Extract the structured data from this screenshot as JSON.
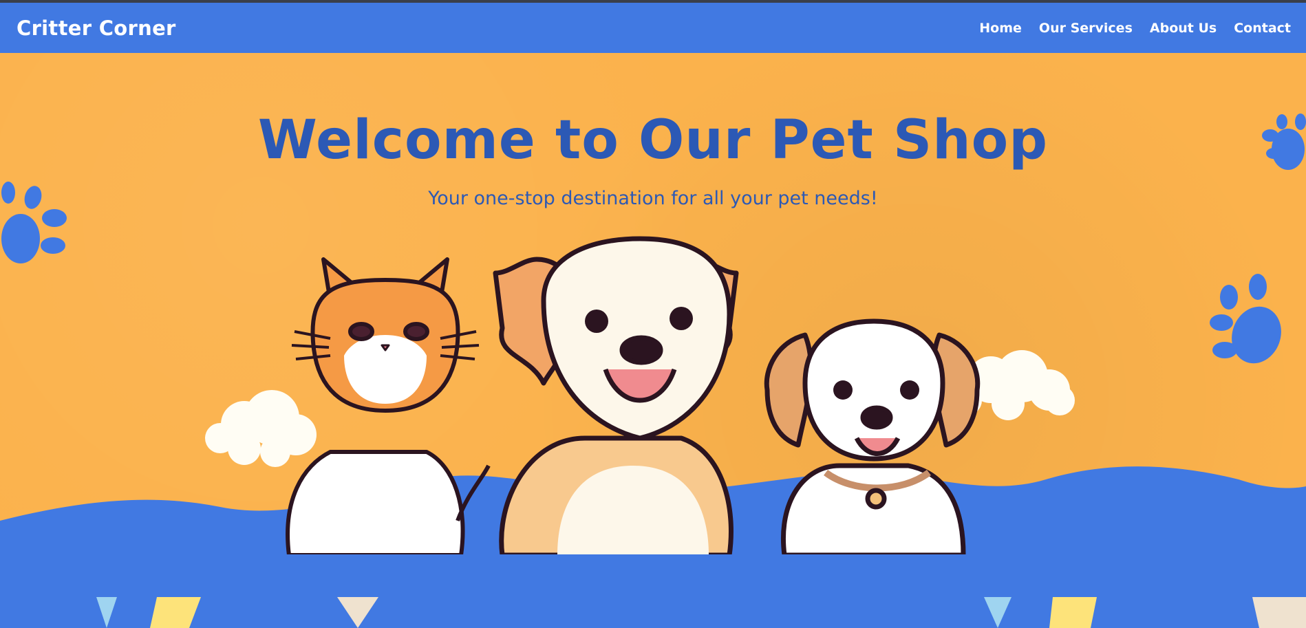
{
  "header": {
    "brand": "Critter Corner",
    "nav": [
      {
        "label": "Home"
      },
      {
        "label": "Our Services"
      },
      {
        "label": "About Us"
      },
      {
        "label": "Contact"
      }
    ]
  },
  "hero": {
    "title": "Welcome to Our Pet Shop",
    "subtitle": "Your one-stop destination for all your pet needs!",
    "illustration": [
      "cat",
      "happy-dog",
      "puppy"
    ],
    "icons": [
      "paw-print-icon",
      "cloud-icon"
    ]
  },
  "colors": {
    "nav_bg": "#4179e2",
    "hero_bg": "#fbb24c",
    "title": "#2c59b5",
    "accent_blue": "#4179e2"
  }
}
